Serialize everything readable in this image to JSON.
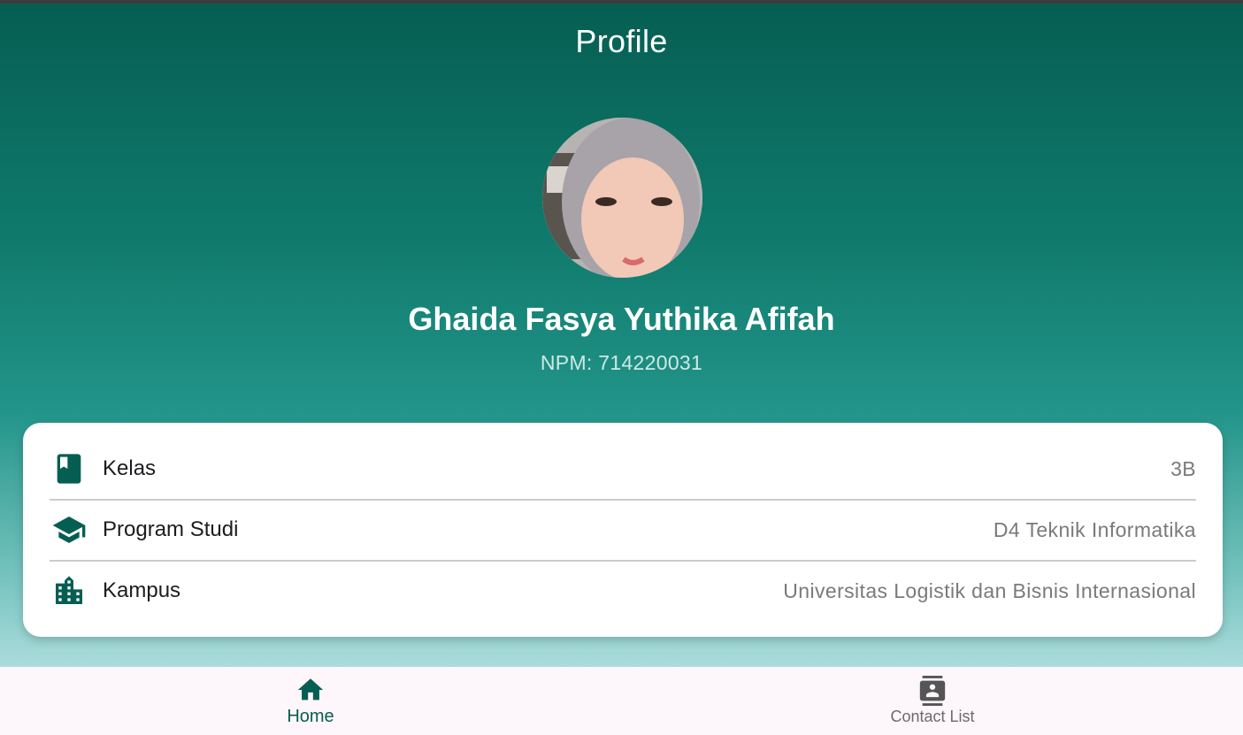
{
  "colors": {
    "accent": "#065e52",
    "header_gradient_top": "#065e52",
    "header_gradient_bottom": "#abdcdb",
    "card_bg": "#ffffff",
    "nav_bg": "#fdf6fb"
  },
  "header": {
    "title": "Profile"
  },
  "profile": {
    "avatar_alt": "profile photo",
    "name": "Ghaida Fasya Yuthika Afifah",
    "npm": "NPM: 714220031"
  },
  "info": [
    {
      "icon": "book-icon",
      "label": "Kelas",
      "value": "3B"
    },
    {
      "icon": "graduation-cap-icon",
      "label": "Program Studi",
      "value": "D4 Teknik Informatika"
    },
    {
      "icon": "building-icon",
      "label": "Kampus",
      "value": "Universitas Logistik dan Bisnis Internasional"
    }
  ],
  "nav": [
    {
      "icon": "home-icon",
      "label": "Home",
      "active": true
    },
    {
      "icon": "contact-list-icon",
      "label": "Contact List",
      "active": false
    }
  ]
}
